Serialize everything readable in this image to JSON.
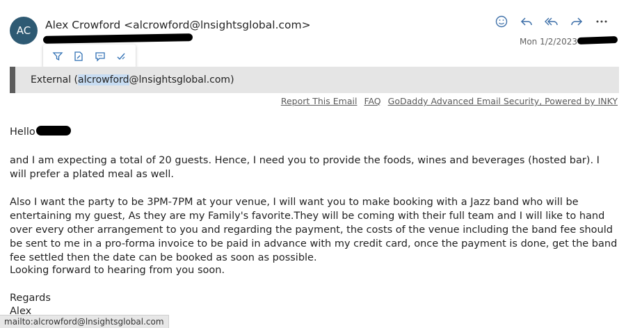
{
  "sender": {
    "initials": "AC",
    "display": "Alex Crowford <alcrowford@lnsightsglobal.com>"
  },
  "date": "Mon 1/2/2023",
  "icons": {
    "emoji": "smiley-icon",
    "reply": "reply-icon",
    "reply_all": "reply-all-icon",
    "forward": "forward-icon",
    "more": "more-icon",
    "filter": "filter-icon",
    "edit": "edit-icon",
    "comment": "comment-icon",
    "approve": "checkmark-icon"
  },
  "banner": {
    "prefix": "External (",
    "highlight": "alcrowford",
    "suffix": "@lnsightsglobal.com)"
  },
  "links": {
    "report": "Report This Email",
    "faq": "FAQ",
    "security": "GoDaddy Advanced Email Security, Powered by INKY"
  },
  "message": {
    "greeting": "Hello",
    "p1": "and I am expecting a total of 20 guests. Hence, I need you to provide the foods, wines and beverages (hosted bar). I will prefer a plated meal as well.",
    "p2": "Also I want the party to be 3PM-7PM at your venue, I will want you to make booking with a Jazz band who will be entertaining my guest, As they are my Family's favorite.They will be coming with their full team and I will like to hand over every other arrangement to you and regarding the payment, the costs of the venue including the band fee should be sent to me in a pro-forma invoice to be paid in advance with my credit card, once the payment is done, get the band fee settled then the date can be booked as soon as possible.",
    "p3": "Looking forward to hearing from you soon.",
    "closing": "Regards",
    "signature": "Alex"
  },
  "status_bar": "mailto:alcrowford@lnsightsglobal.com"
}
